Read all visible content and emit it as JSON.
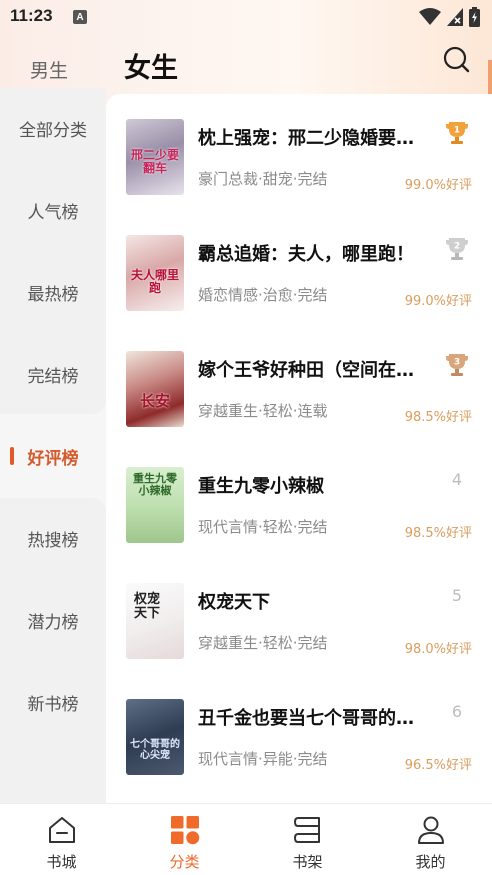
{
  "status": {
    "time": "11:23",
    "badge": "A"
  },
  "header": {
    "male_tab": "男生",
    "female_tab": "女生"
  },
  "sidebar": {
    "items": [
      {
        "label": "全部分类"
      },
      {
        "label": "人气榜"
      },
      {
        "label": "最热榜"
      },
      {
        "label": "完结榜"
      },
      {
        "label": "好评榜"
      },
      {
        "label": "热搜榜"
      },
      {
        "label": "潜力榜"
      },
      {
        "label": "新书榜"
      }
    ],
    "active_index": 4
  },
  "books": [
    {
      "title": "枕上强宠：邢二少隐婚要…",
      "tags": "豪门总裁·甜宠·完结",
      "rating": "99.0%好评",
      "rank": "1",
      "cover_text": "邢二少要翻车"
    },
    {
      "title": "霸总追婚：夫人，哪里跑！",
      "tags": "婚恋情感·治愈·完结",
      "rating": "99.0%好评",
      "rank": "2",
      "cover_text": "夫人哪里跑"
    },
    {
      "title": "嫁个王爷好种田（空间在…",
      "tags": "穿越重生·轻松·连载",
      "rating": "98.5%好评",
      "rank": "3",
      "cover_text": "长安"
    },
    {
      "title": "重生九零小辣椒",
      "tags": "现代言情·轻松·完结",
      "rating": "98.5%好评",
      "rank": "4",
      "cover_text": "重生九零小辣椒"
    },
    {
      "title": "权宠天下",
      "tags": "穿越重生·轻松·完结",
      "rating": "98.0%好评",
      "rank": "5",
      "cover_text": "权宠天下"
    },
    {
      "title": "丑千金也要当七个哥哥的…",
      "tags": "现代言情·异能·完结",
      "rating": "96.5%好评",
      "rank": "6",
      "cover_text": "七个哥哥的心尖宠"
    }
  ],
  "bottom_nav": [
    {
      "label": "书城",
      "icon": "bookstore-icon"
    },
    {
      "label": "分类",
      "icon": "category-icon"
    },
    {
      "label": "书架",
      "icon": "bookshelf-icon"
    },
    {
      "label": "我的",
      "icon": "profile-icon"
    }
  ],
  "colors": {
    "accent": "#f06a2a",
    "rating": "#d99e5e",
    "active_side": "#d45a2c"
  }
}
